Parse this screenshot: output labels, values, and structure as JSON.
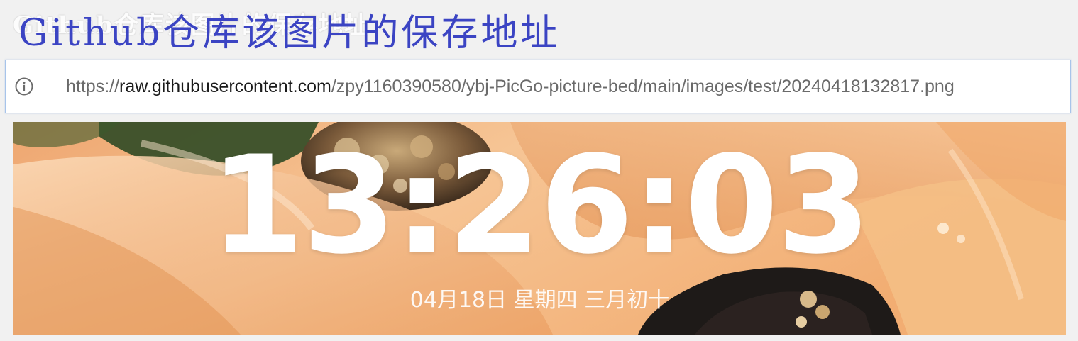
{
  "header": {
    "title": "Github仓库该图片的保存地址",
    "ghost_title": "Github仓库该图片的保存地址"
  },
  "address_bar": {
    "icon": "info-icon",
    "url_scheme": "https://",
    "url_host": "raw.githubusercontent.com",
    "url_path": "/zpy1160390580/ybj-PicGo-picture-bed/main/images/test/20240418132817.png"
  },
  "image": {
    "clock_time": "13:26:03",
    "clock_date": "04月18日 星期四 三月初十"
  },
  "colors": {
    "title": "#3b44c3",
    "address_border": "#a7c4ea",
    "image_orange": "#f3b27a"
  }
}
